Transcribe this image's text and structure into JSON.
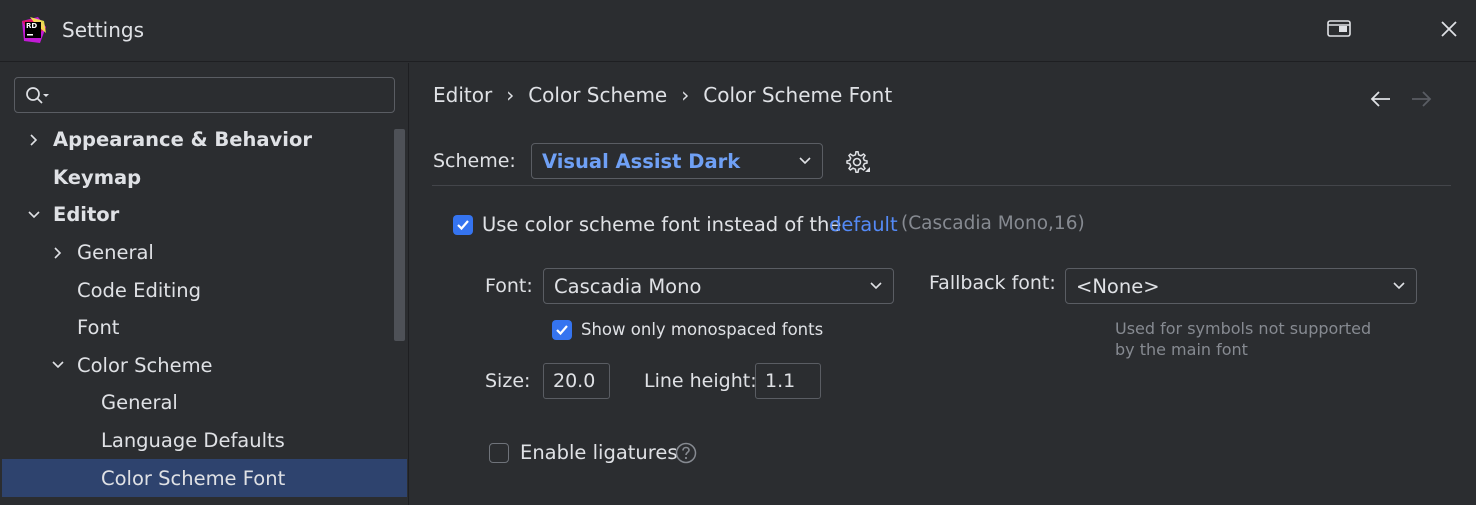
{
  "window": {
    "title": "Settings",
    "logo_text": "RD"
  },
  "sidebar": {
    "search": {
      "value": "",
      "placeholder": ""
    },
    "items": [
      {
        "label": "Appearance & Behavior",
        "level": 0,
        "expandable": true,
        "expanded": false,
        "bold": true,
        "selected": false
      },
      {
        "label": "Keymap",
        "level": 0,
        "expandable": false,
        "expanded": false,
        "bold": true,
        "selected": false
      },
      {
        "label": "Editor",
        "level": 0,
        "expandable": true,
        "expanded": true,
        "bold": true,
        "selected": false
      },
      {
        "label": "General",
        "level": 1,
        "expandable": true,
        "expanded": false,
        "bold": false,
        "selected": false
      },
      {
        "label": "Code Editing",
        "level": 1,
        "expandable": false,
        "expanded": false,
        "bold": false,
        "selected": false
      },
      {
        "label": "Font",
        "level": 1,
        "expandable": false,
        "expanded": false,
        "bold": false,
        "selected": false
      },
      {
        "label": "Color Scheme",
        "level": 1,
        "expandable": true,
        "expanded": true,
        "bold": false,
        "selected": false
      },
      {
        "label": "General",
        "level": 2,
        "expandable": false,
        "expanded": false,
        "bold": false,
        "selected": false
      },
      {
        "label": "Language Defaults",
        "level": 2,
        "expandable": false,
        "expanded": false,
        "bold": false,
        "selected": false
      },
      {
        "label": "Color Scheme Font",
        "level": 2,
        "expandable": false,
        "expanded": false,
        "bold": false,
        "selected": true
      }
    ]
  },
  "breadcrumb": {
    "items": [
      "Editor",
      "Color Scheme",
      "Color Scheme Font"
    ],
    "separator": "›"
  },
  "scheme": {
    "label": "Scheme:",
    "value": "Visual Assist Dark"
  },
  "use_scheme_font": {
    "checked": true,
    "label": "Use color scheme font instead of the",
    "link": "default",
    "hint": "(Cascadia Mono,16)"
  },
  "font": {
    "label": "Font:",
    "value": "Cascadia Mono",
    "monospaced_only": {
      "checked": true,
      "label": "Show only monospaced fonts"
    }
  },
  "fallback": {
    "label": "Fallback font:",
    "value": "<None>",
    "hint_line1": "Used for symbols not supported",
    "hint_line2": "by the main font"
  },
  "size": {
    "label": "Size:",
    "value": "20.0"
  },
  "line_height": {
    "label": "Line height:",
    "value": "1.1"
  },
  "ligatures": {
    "checked": false,
    "label": "Enable ligatures"
  },
  "colors": {
    "background": "#2b2d30",
    "accent": "#3574f0",
    "link": "#548af7",
    "selection": "#2e436e",
    "text": "#dfe1e5",
    "muted": "#868a91"
  },
  "icons": {
    "search": "search-icon",
    "detach": "detach-window-icon",
    "close": "close-icon",
    "back": "back-arrow-icon",
    "forward": "forward-arrow-icon",
    "gear": "gear-icon",
    "help": "help-icon"
  }
}
